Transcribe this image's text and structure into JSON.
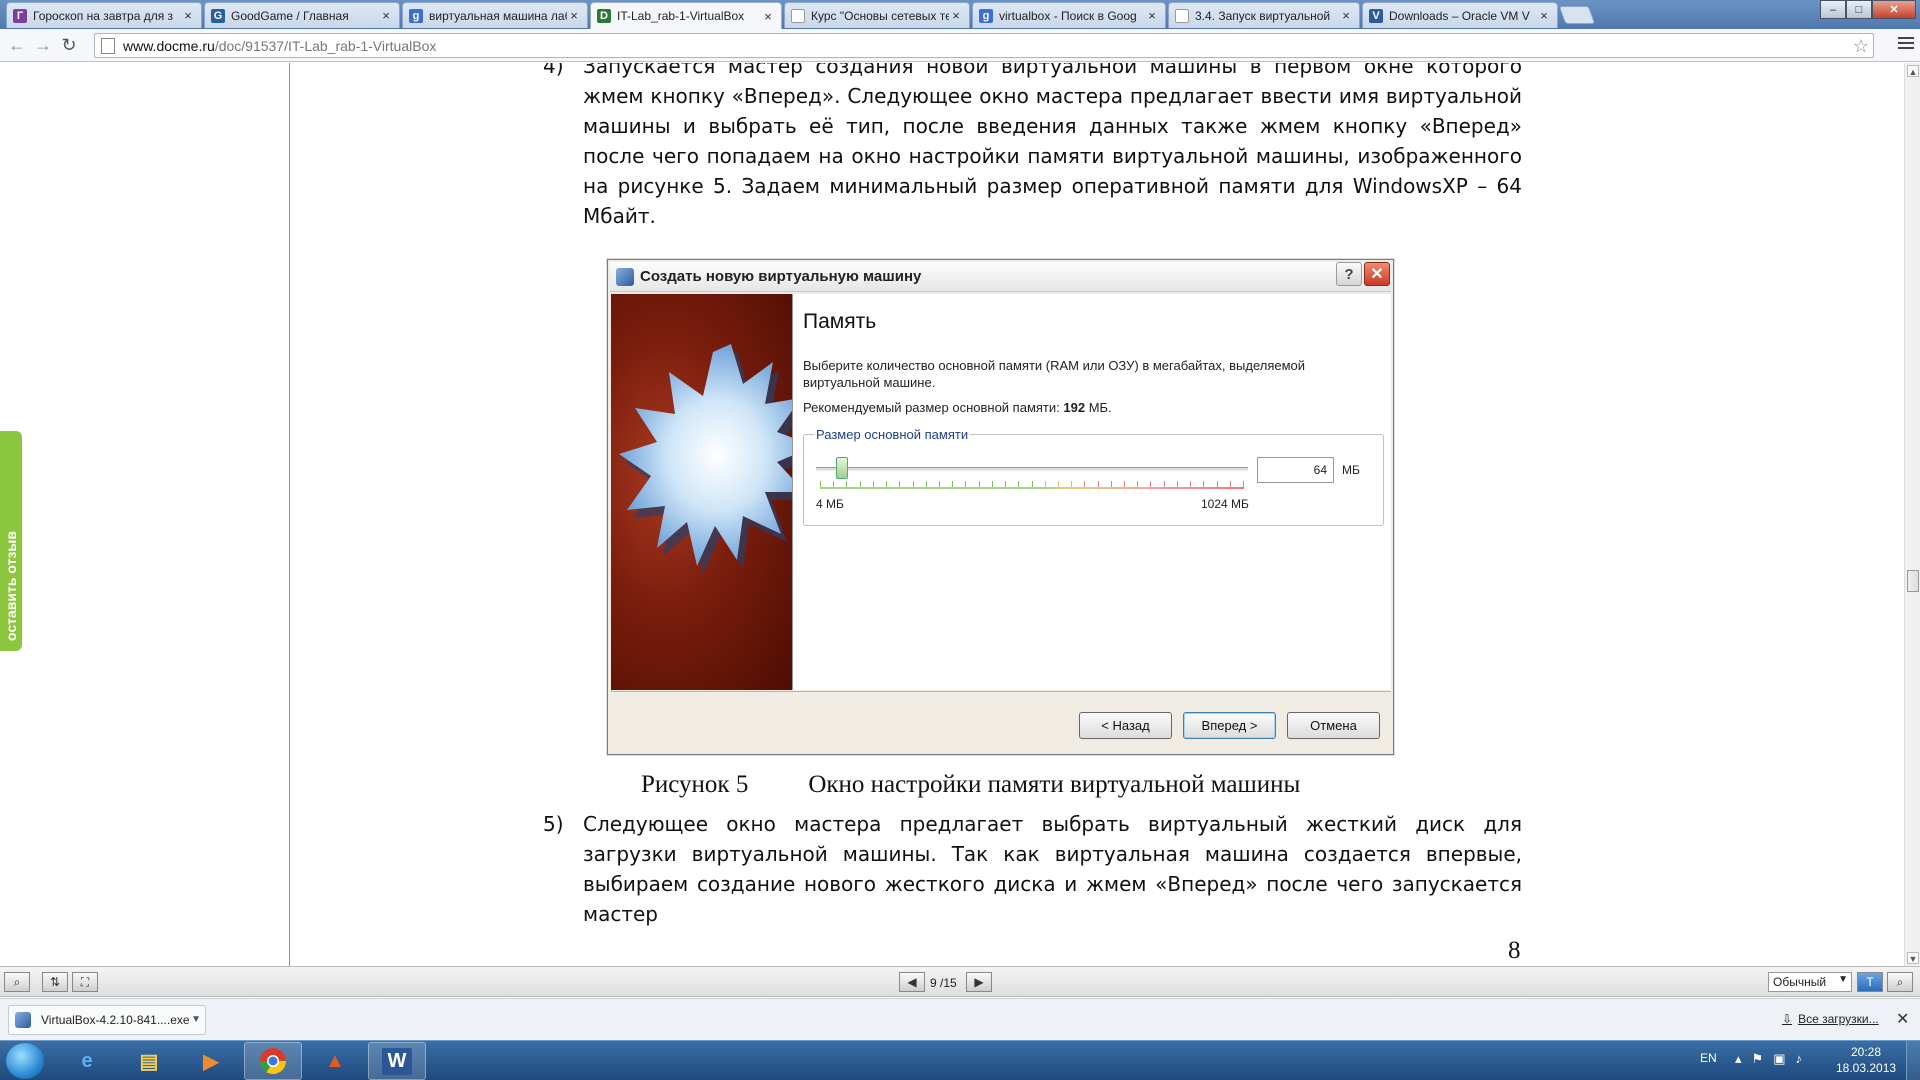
{
  "browser": {
    "tabs": [
      {
        "title": "Гороскоп на завтра для з",
        "icon": "horoscope-favicon",
        "color": "#7b3fa0"
      },
      {
        "title": "GoodGame / Главная",
        "icon": "goodgame-favicon",
        "color": "#2a5f9e"
      },
      {
        "title": "виртуальная машина лаб",
        "icon": "google-favicon",
        "color": "#3b6fd4"
      },
      {
        "title": "IT-Lab_rab-1-VirtualBox",
        "icon": "docme-favicon",
        "color": "#2c7a3a"
      },
      {
        "title": "Курс \"Основы сетевых те",
        "icon": "page-favicon",
        "color": "#999999"
      },
      {
        "title": "virtualbox - Поиск в Goog",
        "icon": "google-favicon",
        "color": "#3b6fd4"
      },
      {
        "title": "3.4. Запуск виртуальной",
        "icon": "page-favicon",
        "color": "#999999"
      },
      {
        "title": "Downloads – Oracle VM V",
        "icon": "oracle-favicon",
        "color": "#2c5aa0"
      }
    ],
    "tab_close_glyph": "×",
    "address": {
      "host": "www.docme.ru",
      "path": "/doc/91537/IT-Lab_rab-1-VirtualBox"
    },
    "window_buttons": {
      "minimize": "–",
      "maximize": "□",
      "close": "✕"
    }
  },
  "document": {
    "para4_num": "4)",
    "para4_text": "Запускается мастер создания новой виртуальной машины в первом окне которого жмем кнопку «Вперед». Следующее окно мастера предлагает ввести имя виртуальной машины и выбрать её тип, после введения данных также жмем кнопку «Вперед» после чего попадаем на окно настройки памяти виртуальной машины, изображенного на рисунке 5. Задаем минимальный размер оперативной памяти для WindowsXP – 64 Мбайт.",
    "caption_num": "Рисунок 5",
    "caption_text": "Окно настройки памяти виртуальной машины",
    "para5_num": "5)",
    "para5_text": "Следующее окно мастера предлагает выбрать виртуальный жесткий диск для загрузки виртуальной машины. Так как виртуальная машина создается впервые, выбираем создание нового жесткого диска и жмем «Вперед» после чего запускается мастер",
    "page_number": "8"
  },
  "feedback_tab": "оставить отзыв",
  "vbox_dialog": {
    "title": "Создать новую виртуальную машину",
    "help": "?",
    "close": "✕",
    "heading": "Память",
    "description": "Выберите количество основной памяти (RAM или ОЗУ) в мегабайтах, выделяемой виртуальной машине.",
    "recommended_prefix": "Рекомендуемый размер основной памяти: ",
    "recommended_value": "192",
    "recommended_suffix": " МБ.",
    "group_label": "Размер основной памяти",
    "slider_value_fraction": 0.06,
    "slider_min": "4 МБ",
    "slider_max": "1024 МБ",
    "memory_value": "64",
    "memory_unit": "МБ",
    "back_button": "< Назад",
    "next_button": "Вперед >",
    "cancel_button": "Отмена"
  },
  "viewer_toolbar": {
    "page_current": "9",
    "page_total": "/15",
    "zoom_mode": "Обычный"
  },
  "downloads": {
    "file": "VirtualBox-4.2.10-841....exe",
    "show_all": "Все загрузки..."
  },
  "taskbar": {
    "apps": [
      "internet-explorer",
      "file-explorer",
      "media-player",
      "chrome",
      "matlab",
      "word"
    ],
    "language": "EN",
    "time": "20:28",
    "date": "18.03.2013"
  }
}
